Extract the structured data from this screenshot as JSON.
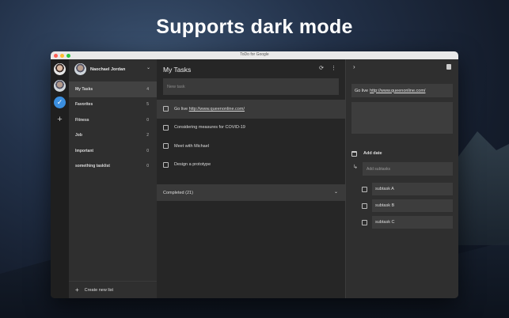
{
  "headline": "Supports dark mode",
  "window": {
    "title": "ToDo for Google"
  },
  "account_rail": {
    "items": [
      {
        "icon": "user-avatar"
      },
      {
        "icon": "user-avatar"
      },
      {
        "icon": "check-icon",
        "glyph": "✓"
      }
    ],
    "add_glyph": "+"
  },
  "sidebar": {
    "profile_name": "Naochael Jordan",
    "profile_chevron": "⌄",
    "lists": [
      {
        "label": "My Tasks",
        "count": "4"
      },
      {
        "label": "Favorites",
        "count": "5"
      },
      {
        "label": "Fitness",
        "count": "0"
      },
      {
        "label": "Job",
        "count": "2"
      },
      {
        "label": "Important",
        "count": "0"
      },
      {
        "label": "something tasklist",
        "count": "0"
      }
    ],
    "create_label": "Create new list",
    "create_glyph": "+"
  },
  "main": {
    "title": "My Tasks",
    "refresh_glyph": "⟳",
    "menu_glyph": "⋮",
    "new_task_placeholder": "New task",
    "tasks": [
      {
        "prefix": "Go live",
        "link": "http://www.queenonline.com/"
      },
      {
        "prefix": "Considering measures for COVID-19",
        "link": ""
      },
      {
        "prefix": "Meet with Michael",
        "link": ""
      },
      {
        "prefix": "Design a prototype",
        "link": ""
      }
    ],
    "completed_label": "Completed (21)",
    "completed_chevron": "⌄"
  },
  "details": {
    "close_glyph": "›",
    "title_prefix": "Go live",
    "title_link": "http://www.queenonline.com/",
    "add_date_label": "Add date",
    "subtask_arrow": "↳",
    "add_subtask_placeholder": "Add subtasks",
    "subtasks": [
      "subtask A",
      "subtask B",
      "subtask C"
    ]
  },
  "colors": {
    "accent": "#3b8fe0",
    "window_bg": "#2b2b2b",
    "panel_bg": "#3d3d3d"
  }
}
